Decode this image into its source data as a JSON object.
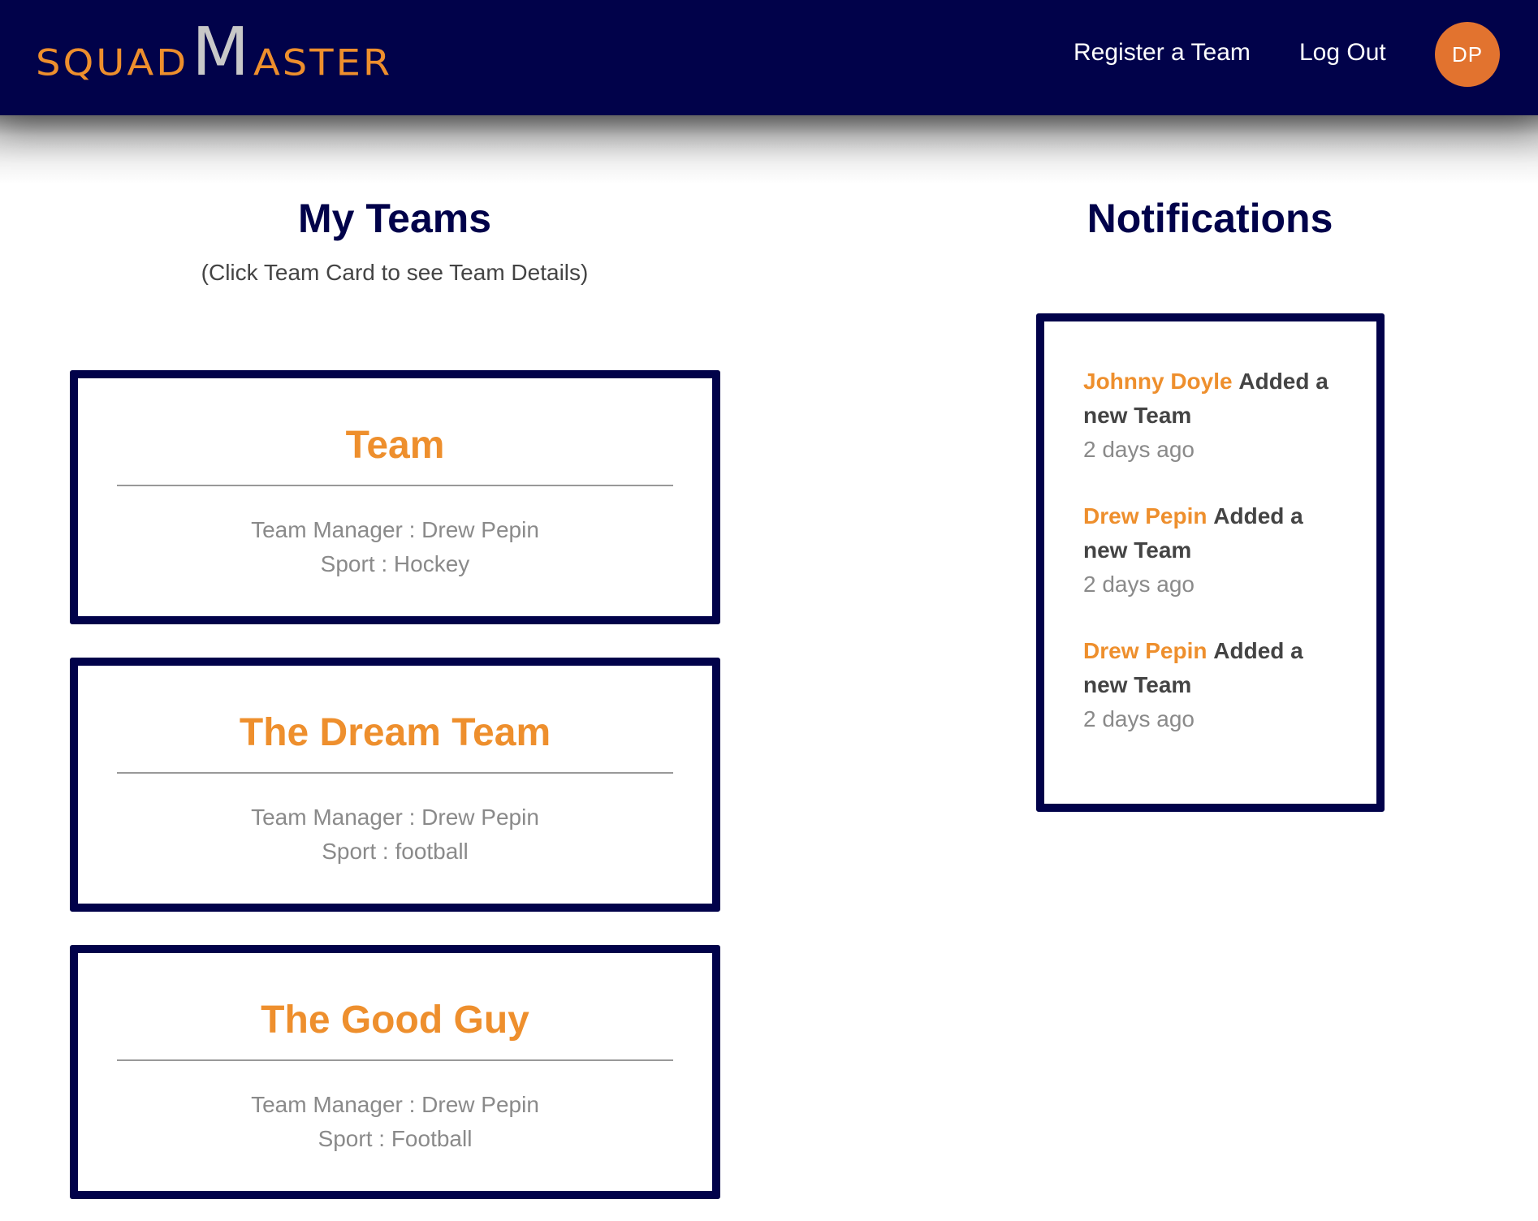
{
  "app": {
    "logo": {
      "part1": "SQUAD",
      "part2": "M",
      "part3": "ASTER"
    },
    "nav": {
      "register_label": "Register a Team",
      "logout_label": "Log Out",
      "avatar_initials": "DP"
    }
  },
  "my_teams": {
    "title": "My Teams",
    "subtitle": "(Click Team Card to see Team Details)",
    "cards": [
      {
        "name": "Team",
        "manager": "Team Manager : Drew Pepin",
        "sport": "Sport : Hockey"
      },
      {
        "name": "The Dream Team",
        "manager": "Team Manager : Drew Pepin",
        "sport": "Sport : football"
      },
      {
        "name": "The Good Guy",
        "manager": "Team Manager : Drew Pepin",
        "sport": "Sport : Football"
      }
    ]
  },
  "notifications": {
    "title": "Notifications",
    "items": [
      {
        "who": "Johnny Doyle",
        "what": "Added a new Team",
        "when": "2 days ago"
      },
      {
        "who": "Drew Pepin",
        "what": "Added a new Team",
        "when": "2 days ago"
      },
      {
        "who": "Drew Pepin",
        "what": "Added a new Team",
        "when": "2 days ago"
      }
    ]
  },
  "colors": {
    "navy": "#01024a",
    "orange": "#ee8f2d",
    "avatar": "#e2732f",
    "logo_m": "#c8c8c8"
  }
}
